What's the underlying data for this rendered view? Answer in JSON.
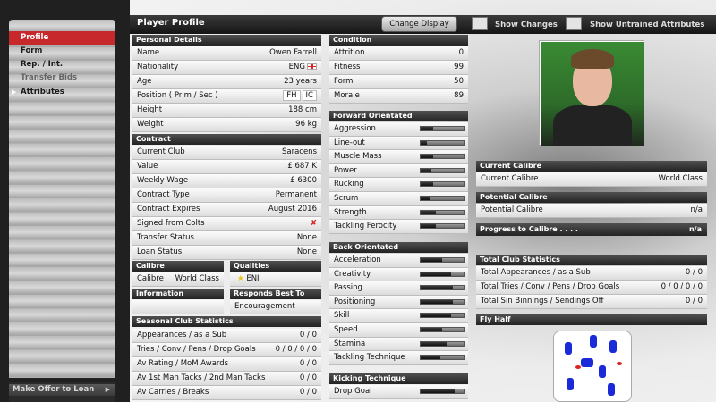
{
  "menu": {
    "items": [
      {
        "label": "Profile",
        "state": "active"
      },
      {
        "label": "Form",
        "state": "normal"
      },
      {
        "label": "Rep. / Int.",
        "state": "normal"
      },
      {
        "label": "Transfer Bids",
        "state": "disabled"
      },
      {
        "label": "Attributes",
        "state": "current"
      }
    ],
    "bottom": [
      {
        "label": "Make Offer to Loan"
      }
    ]
  },
  "header": {
    "title": "Player Profile",
    "change_display": "Change Display",
    "show_changes": "Show Changes",
    "show_untrained": "Show Untrained Attributes"
  },
  "personal": {
    "title": "Personal Details",
    "name": {
      "label": "Name",
      "value": "Owen Farrell"
    },
    "nationality": {
      "label": "Nationality",
      "value": "ENG"
    },
    "age": {
      "label": "Age",
      "value": "23 years"
    },
    "position": {
      "label": "Position ( Prim / Sec )",
      "prim": "FH",
      "sec": "IC"
    },
    "height": {
      "label": "Height",
      "value": "188 cm"
    },
    "weight": {
      "label": "Weight",
      "value": "96 kg"
    }
  },
  "contract": {
    "title": "Contract",
    "rows": [
      {
        "label": "Current Club",
        "value": "Saracens"
      },
      {
        "label": "Value",
        "value": "£ 687 K"
      },
      {
        "label": "Weekly Wage",
        "value": "£ 6300"
      },
      {
        "label": "Contract Type",
        "value": "Permanent"
      },
      {
        "label": "Contract Expires",
        "value": "August 2016"
      },
      {
        "label": "Signed from Colts",
        "value": "✘"
      },
      {
        "label": "Transfer Status",
        "value": "None"
      },
      {
        "label": "Loan Status",
        "value": "None"
      }
    ]
  },
  "calibre_box": {
    "title": "Calibre",
    "label": "Calibre",
    "value": "World Class"
  },
  "qualities": {
    "title": "Qualities",
    "value": "ENI"
  },
  "information": {
    "title": "Information"
  },
  "responds": {
    "title": "Responds Best To",
    "value": "Encouragement"
  },
  "seasonal": {
    "title": "Seasonal Club Statistics",
    "rows": [
      {
        "label": "Appearances / as a Sub",
        "value": "0 / 0"
      },
      {
        "label": "Tries / Conv / Pens / Drop Goals",
        "value": "0 / 0 / 0 / 0"
      },
      {
        "label": "Av Rating / MoM Awards",
        "value": "0 / 0"
      },
      {
        "label": "Av 1st Man Tacks / 2nd Man Tacks",
        "value": "0 / 0"
      },
      {
        "label": "Av Carries / Breaks",
        "value": "0 / 0"
      }
    ]
  },
  "condition": {
    "title": "Condition",
    "rows": [
      {
        "label": "Attrition",
        "value": "0"
      },
      {
        "label": "Fitness",
        "value": "99"
      },
      {
        "label": "Form",
        "value": "50"
      },
      {
        "label": "Morale",
        "value": "89"
      }
    ]
  },
  "forward": {
    "title": "Forward Orientated",
    "rows": [
      {
        "label": "Aggression",
        "level": 0.3
      },
      {
        "label": "Line-out",
        "level": 0.15
      },
      {
        "label": "Muscle Mass",
        "level": 0.3
      },
      {
        "label": "Power",
        "level": 0.25
      },
      {
        "label": "Rucking",
        "level": 0.3
      },
      {
        "label": "Scrum",
        "level": 0.2
      },
      {
        "label": "Strength",
        "level": 0.35
      },
      {
        "label": "Tackling Ferocity",
        "level": 0.35
      }
    ]
  },
  "back": {
    "title": "Back Orientated",
    "rows": [
      {
        "label": "Acceleration",
        "level": 0.5
      },
      {
        "label": "Creativity",
        "level": 0.7
      },
      {
        "label": "Passing",
        "level": 0.75
      },
      {
        "label": "Positioning",
        "level": 0.75
      },
      {
        "label": "Skill",
        "level": 0.7
      },
      {
        "label": "Speed",
        "level": 0.5
      },
      {
        "label": "Stamina",
        "level": 0.6
      },
      {
        "label": "Tackling Technique",
        "level": 0.45
      }
    ]
  },
  "kicking": {
    "title": "Kicking Technique",
    "rows": [
      {
        "label": "Drop Goal",
        "level": 0.8
      }
    ]
  },
  "current_calibre": {
    "title": "Current Calibre",
    "label": "Current Calibre",
    "value": "World Class"
  },
  "potential_calibre": {
    "title": "Potential Calibre",
    "label": "Potential Calibre",
    "value": "n/a"
  },
  "progress": {
    "title": "Progress to Calibre . . . .",
    "value": "n/a"
  },
  "total": {
    "title": "Total Club Statistics",
    "rows": [
      {
        "label": "Total Appearances / as a Sub",
        "value": "0 / 0"
      },
      {
        "label": "Total Tries / Conv / Pens / Drop Goals",
        "value": "0 / 0 / 0 / 0"
      },
      {
        "label": "Total Sin Binnings / Sendings Off",
        "value": "0 / 0"
      }
    ]
  },
  "fly_half": {
    "title": "Fly Half"
  },
  "colors": {
    "active": "#c6282c",
    "header": "#232323",
    "player_icon": "#1a2ad8"
  }
}
